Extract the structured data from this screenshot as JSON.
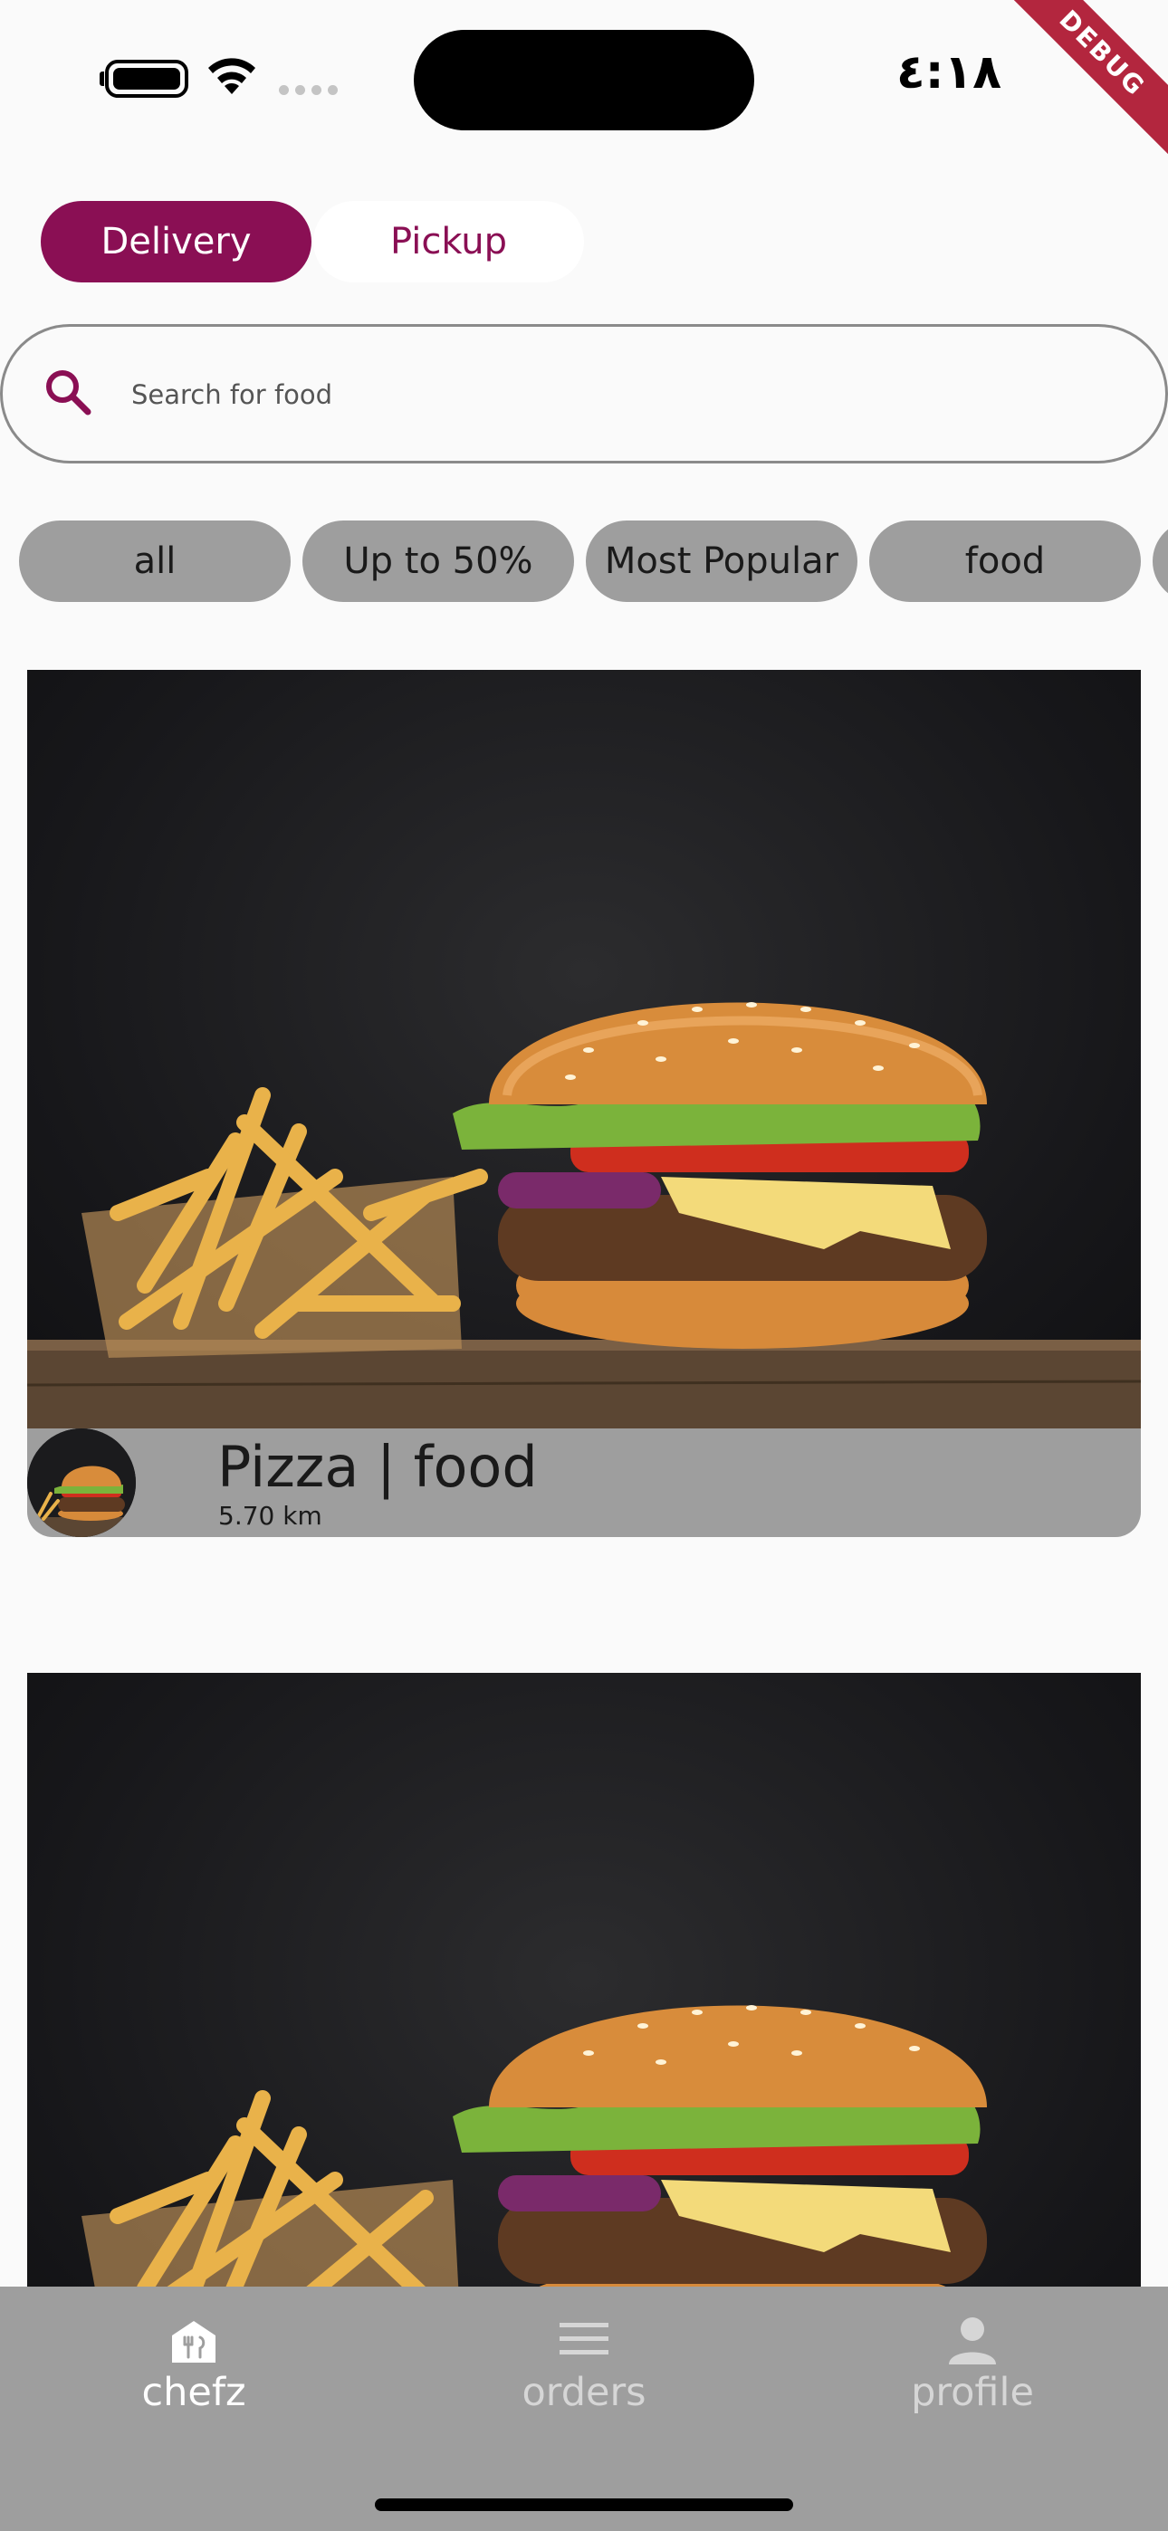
{
  "status_bar": {
    "time": "٤:١٨"
  },
  "debug_banner": "DEBUG",
  "mode_toggle": {
    "delivery": "Delivery",
    "pickup": "Pickup",
    "selected": "Delivery"
  },
  "search": {
    "placeholder": "Search for food"
  },
  "chips": [
    "all",
    "Up to 50%",
    "Most Popular",
    "food"
  ],
  "cards": [
    {
      "title": "Pizza  |  food",
      "distance": "5.70 km"
    },
    {
      "title": "",
      "distance": ""
    }
  ],
  "bottom_nav": {
    "items": [
      {
        "label": "chefz",
        "icon": "chef-home-icon",
        "active": true
      },
      {
        "label": "orders",
        "icon": "list-icon",
        "active": false
      },
      {
        "label": "profile",
        "icon": "person-icon",
        "active": false
      }
    ]
  },
  "colors": {
    "brand": "#8a0f54",
    "chip_bg": "#9e9e9e",
    "nav_bg": "#9e9e9e",
    "debug": "#b3263e"
  }
}
